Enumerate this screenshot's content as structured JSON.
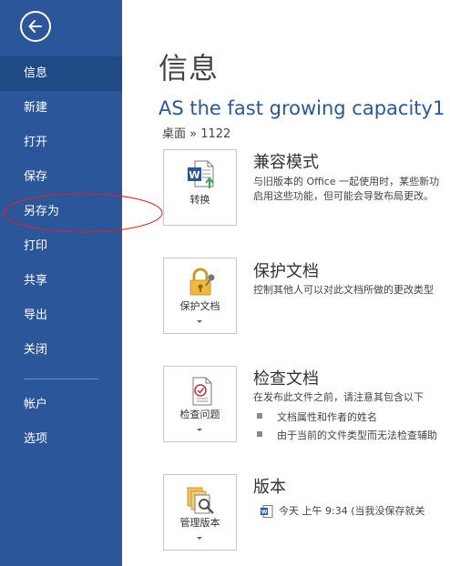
{
  "sidebar": {
    "items": [
      {
        "label": "信息",
        "active": true
      },
      {
        "label": "新建"
      },
      {
        "label": "打开"
      },
      {
        "label": "保存"
      },
      {
        "label": "另存为"
      },
      {
        "label": "打印"
      },
      {
        "label": "共享"
      },
      {
        "label": "导出"
      },
      {
        "label": "关闭"
      },
      {
        "label": "帐户"
      },
      {
        "label": "选项"
      }
    ]
  },
  "main": {
    "page_title": "信息",
    "doc_title": "AS the fast growing capacity1",
    "doc_path": "桌面 » 1122",
    "sections": [
      {
        "tile_label": "转换",
        "title": "兼容模式",
        "desc_lines": [
          "与旧版本的 Office 一起使用时，某些新功",
          "启用这些功能，但可能会导致布局更改。"
        ]
      },
      {
        "tile_label": "保护文档",
        "title": "保护文档",
        "desc_lines": [
          "控制其他人可以对此文档所做的更改类型"
        ]
      },
      {
        "tile_label": "检查问题",
        "title": "检查文档",
        "desc_lines": [
          "在发布此文件之前，请注意其包含以下"
        ],
        "bullets": [
          "文档属性和作者的姓名",
          "由于当前的文件类型而无法检查辅助"
        ]
      },
      {
        "tile_label": "管理版本",
        "title": "版本",
        "version_entry": "今天 上午 9:34 (当我没保存就关"
      }
    ]
  },
  "colors": {
    "sidebar_bg": "#2b579a",
    "active_item_bg": "#1f4a86",
    "accent": "#2b579a",
    "annotation_red": "#e02020"
  }
}
